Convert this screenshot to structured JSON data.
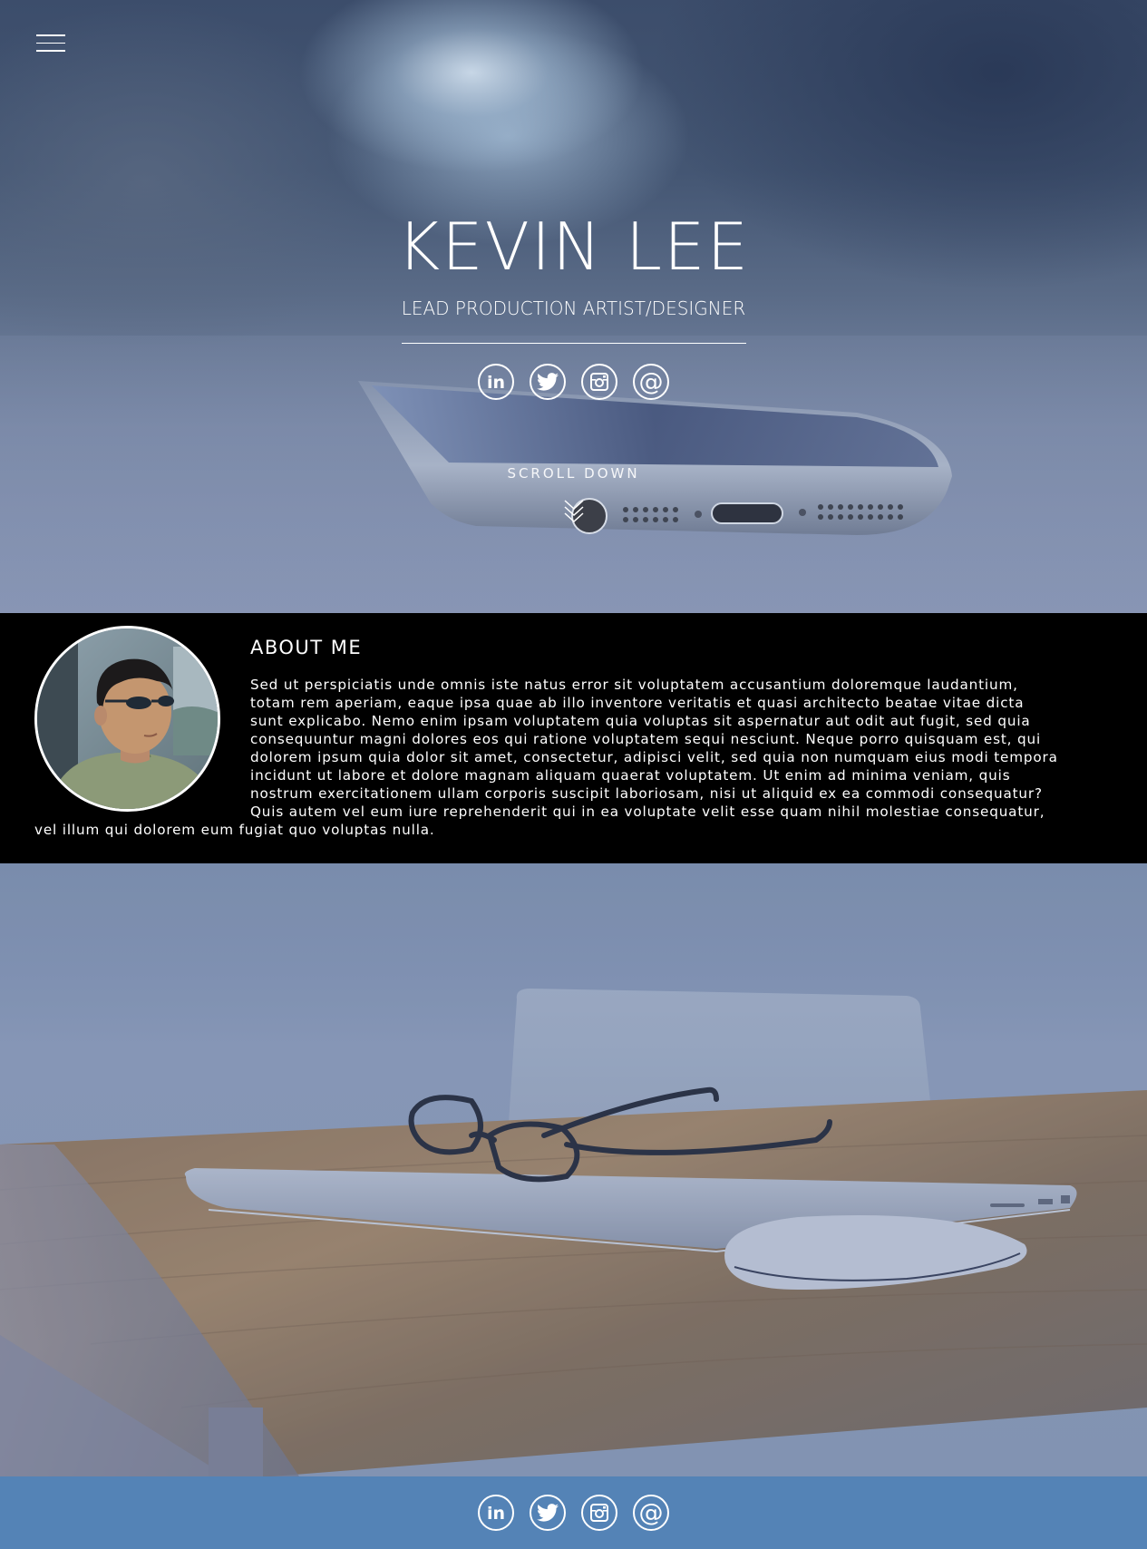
{
  "nav": {
    "menu_icon": "hamburger-menu-icon"
  },
  "hero": {
    "name": "KEVIN LEE",
    "title": "LEAD PRODUCTION ARTIST/DESIGNER",
    "scroll_label": "SCROLL DOWN",
    "social": [
      {
        "icon": "linkedin-icon",
        "label": "in"
      },
      {
        "icon": "twitter-icon"
      },
      {
        "icon": "instagram-icon"
      },
      {
        "icon": "email-icon",
        "label": "@"
      }
    ]
  },
  "about": {
    "heading": "ABOUT ME",
    "body": "Sed ut perspiciatis unde omnis iste natus error sit voluptatem accusantium doloremque laudantium, totam rem aperiam, eaque ipsa quae ab illo inventore veritatis et quasi architecto beatae vitae dicta sunt explicabo. Nemo enim ipsam voluptatem quia voluptas sit aspernatur aut odit aut fugit, sed quia consequuntur magni dolores eos qui ratione voluptatem sequi nesciunt. Neque porro quisquam est, qui dolorem ipsum quia dolor sit amet, consectetur, adipisci velit, sed quia non numquam eius modi tempora incidunt ut labore et dolore magnam aliquam quaerat voluptatem. Ut enim ad minima veniam, quis nostrum exercitationem ullam corporis suscipit laboriosam, nisi ut aliquid ex ea commodi consequatur? Quis autem vel eum iure reprehenderit qui in ea voluptate velit esse quam nihil molestiae consequatur, vel illum qui dolorem eum fugiat quo voluptas nulla."
  },
  "footer": {
    "social": [
      {
        "icon": "linkedin-icon",
        "label": "in"
      },
      {
        "icon": "twitter-icon"
      },
      {
        "icon": "instagram-icon"
      },
      {
        "icon": "email-icon",
        "label": "@"
      }
    ]
  },
  "colors": {
    "footer_bg": "#5483b6",
    "about_bg": "#000000",
    "text": "#ffffff"
  }
}
